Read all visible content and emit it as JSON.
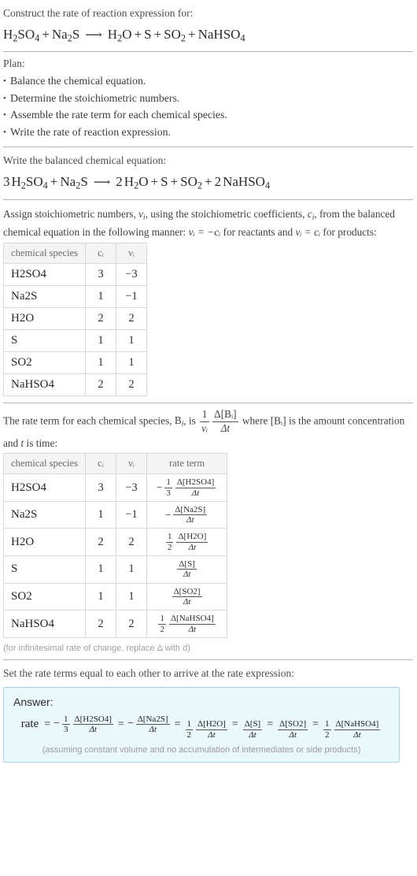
{
  "header": {
    "prompt": "Construct the rate of reaction expression for:",
    "reaction": {
      "reactants": [
        {
          "coef": "",
          "formula": "H_2SO_4"
        },
        {
          "coef": "",
          "formula": "Na_2S"
        }
      ],
      "products": [
        {
          "coef": "",
          "formula": "H_2O"
        },
        {
          "coef": "",
          "formula": "S"
        },
        {
          "coef": "",
          "formula": "SO_2"
        },
        {
          "coef": "",
          "formula": "NaHSO_4"
        }
      ],
      "arrow": "⟶"
    }
  },
  "plan": {
    "title": "Plan:",
    "steps": [
      "Balance the chemical equation.",
      "Determine the stoichiometric numbers.",
      "Assemble the rate term for each chemical species.",
      "Write the rate of reaction expression."
    ]
  },
  "balanced": {
    "title": "Write the balanced chemical equation:",
    "reaction": {
      "reactants": [
        {
          "coef": "3",
          "formula": "H_2SO_4"
        },
        {
          "coef": "",
          "formula": "Na_2S"
        }
      ],
      "products": [
        {
          "coef": "2",
          "formula": "H_2O"
        },
        {
          "coef": "",
          "formula": "S"
        },
        {
          "coef": "",
          "formula": "SO_2"
        },
        {
          "coef": "2",
          "formula": "NaHSO_4"
        }
      ],
      "arrow": "⟶"
    }
  },
  "stoich": {
    "intro_1": "Assign stoichiometric numbers, ",
    "intro_2": ", using the stoichiometric coefficients, ",
    "intro_3": ", from the balanced chemical equation in the following manner: ",
    "intro_4": " for reactants and ",
    "intro_5": " for products:",
    "sym_nu": "ν",
    "sym_c": "c",
    "sub_i": "i",
    "rule_reactants": "νᵢ = −cᵢ",
    "rule_products": "νᵢ = cᵢ",
    "headers": [
      "chemical species",
      "cᵢ",
      "νᵢ"
    ],
    "rows": [
      {
        "species": "H_2SO_4",
        "c": "3",
        "nu": "−3"
      },
      {
        "species": "Na_2S",
        "c": "1",
        "nu": "−1"
      },
      {
        "species": "H_2O",
        "c": "2",
        "nu": "2"
      },
      {
        "species": "S",
        "c": "1",
        "nu": "1"
      },
      {
        "species": "SO_2",
        "c": "1",
        "nu": "1"
      },
      {
        "species": "NaHSO_4",
        "c": "2",
        "nu": "2"
      }
    ]
  },
  "rate_terms": {
    "intro_1": "The rate term for each chemical species, ",
    "intro_2": ", is ",
    "intro_3": " where ",
    "intro_4": " is the amount concentration and ",
    "intro_5": " is time:",
    "sym_B": "B",
    "sym_t": "t",
    "bracket_B": "[Bᵢ]",
    "frac_one": "1",
    "frac_nu": "νᵢ",
    "delta_B": "Δ[Bᵢ]",
    "delta_t": "Δt",
    "headers": [
      "chemical species",
      "cᵢ",
      "νᵢ",
      "rate term"
    ],
    "rows": [
      {
        "species": "H_2SO_4",
        "c": "3",
        "nu": "−3",
        "sign": "−",
        "coef_num": "1",
        "coef_den": "3",
        "delta_num": "Δ[H_2SO_4]",
        "delta_den": "Δt"
      },
      {
        "species": "Na_2S",
        "c": "1",
        "nu": "−1",
        "sign": "−",
        "coef_num": "",
        "coef_den": "",
        "delta_num": "Δ[Na_2S]",
        "delta_den": "Δt"
      },
      {
        "species": "H_2O",
        "c": "2",
        "nu": "2",
        "sign": "",
        "coef_num": "1",
        "coef_den": "2",
        "delta_num": "Δ[H_2O]",
        "delta_den": "Δt"
      },
      {
        "species": "S",
        "c": "1",
        "nu": "1",
        "sign": "",
        "coef_num": "",
        "coef_den": "",
        "delta_num": "Δ[S]",
        "delta_den": "Δt"
      },
      {
        "species": "SO_2",
        "c": "1",
        "nu": "1",
        "sign": "",
        "coef_num": "",
        "coef_den": "",
        "delta_num": "Δ[SO_2]",
        "delta_den": "Δt"
      },
      {
        "species": "NaHSO_4",
        "c": "2",
        "nu": "2",
        "sign": "",
        "coef_num": "1",
        "coef_den": "2",
        "delta_num": "Δ[NaHSO_4]",
        "delta_den": "Δt"
      }
    ],
    "footnote": "(for infinitesimal rate of change, replace Δ with d)"
  },
  "final": {
    "intro": "Set the rate terms equal to each other to arrive at the rate expression:",
    "answer_label": "Answer:",
    "rate_word": "rate",
    "equals": "=",
    "terms": [
      {
        "sign": "−",
        "coef_num": "1",
        "coef_den": "3",
        "delta_num": "Δ[H_2SO_4]",
        "delta_den": "Δt"
      },
      {
        "sign": "−",
        "coef_num": "",
        "coef_den": "",
        "delta_num": "Δ[Na_2S]",
        "delta_den": "Δt"
      },
      {
        "sign": "",
        "coef_num": "1",
        "coef_den": "2",
        "delta_num": "Δ[H_2O]",
        "delta_den": "Δt"
      },
      {
        "sign": "",
        "coef_num": "",
        "coef_den": "",
        "delta_num": "Δ[S]",
        "delta_den": "Δt"
      },
      {
        "sign": "",
        "coef_num": "",
        "coef_den": "",
        "delta_num": "Δ[SO_2]",
        "delta_den": "Δt"
      },
      {
        "sign": "",
        "coef_num": "1",
        "coef_den": "2",
        "delta_num": "Δ[NaHSO_4]",
        "delta_den": "Δt"
      }
    ],
    "note": "(assuming constant volume and no accumulation of intermediates or side products)"
  },
  "colors": {
    "answer_border": "#a5d3e2",
    "answer_bg": "#eaf7fb",
    "divider": "#b3b3b3",
    "table_border": "#d8d8d8",
    "header_bg": "#f4f4f4"
  }
}
